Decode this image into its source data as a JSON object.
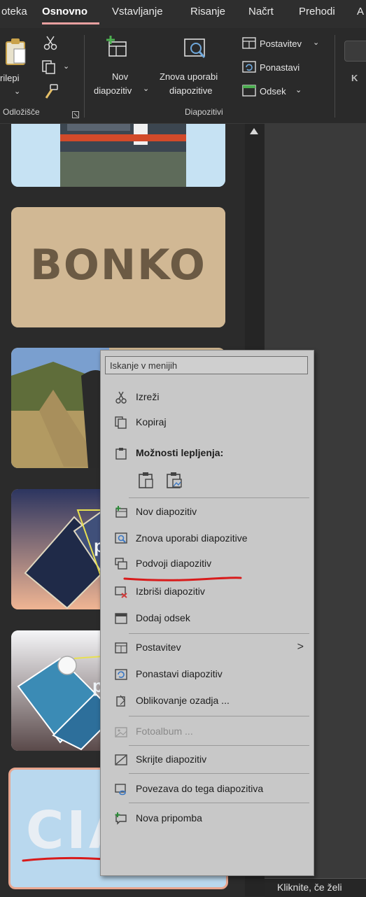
{
  "ribbon": {
    "tabs": [
      "oteka",
      "Osnovno",
      "Vstavljanje",
      "Risanje",
      "Načrt",
      "Prehodi",
      "A"
    ],
    "clipboard": {
      "paste": "rilepi",
      "group_label": "Odložišče"
    },
    "slides": {
      "new_slide_line1": "Nov",
      "new_slide_line2": "diapozitiv",
      "reuse_line1": "Znova uporabi",
      "reuse_line2": "diapozitive",
      "layout": "Postavitev",
      "reset": "Ponastavi",
      "section": "Odsek",
      "group_label": "Diapozitivi"
    },
    "font_letter": "K"
  },
  "thumbnails": {
    "bonko_text": "BONKO",
    "po_text_1": "po",
    "po_text_2": "po",
    "ciao_text": "CIAO"
  },
  "context_menu": {
    "search_placeholder": "Iskanje v menijih",
    "items": [
      {
        "label": "Izreži",
        "icon": "scissors-icon"
      },
      {
        "label": "Kopiraj",
        "icon": "copy-icon"
      },
      {
        "label": "Možnosti lepljenja:",
        "icon": "paste-icon"
      },
      {
        "label": "Nov diapozitiv",
        "icon": "new-slide-icon"
      },
      {
        "label": "Znova uporabi diapozitive",
        "icon": "reuse-slides-icon"
      },
      {
        "label": "Podvoji diapozitiv",
        "icon": "duplicate-slide-icon"
      },
      {
        "label": "Izbriši diapozitiv",
        "icon": "delete-slide-icon"
      },
      {
        "label": "Dodaj odsek",
        "icon": "add-section-icon"
      },
      {
        "label": "Postavitev",
        "icon": "layout-icon"
      },
      {
        "label": "Ponastavi diapozitiv",
        "icon": "reset-slide-icon"
      },
      {
        "label": "Oblikovanje ozadja ...",
        "icon": "format-background-icon"
      },
      {
        "label": "Fotoalbum ...",
        "icon": "photo-album-icon",
        "disabled": true
      },
      {
        "label": "Skrijte diapozitiv",
        "icon": "hide-slide-icon"
      },
      {
        "label": "Povezava do tega diapozitiva",
        "icon": "link-slide-icon"
      },
      {
        "label": "Nova pripomba",
        "icon": "new-comment-icon"
      }
    ]
  },
  "notes": {
    "placeholder": "Kliknite, če želi"
  },
  "colors": {
    "annotation_red": "#d81b1b",
    "tab_accent": "#e8a0a0",
    "menu_bg": "#c8c8c8"
  }
}
